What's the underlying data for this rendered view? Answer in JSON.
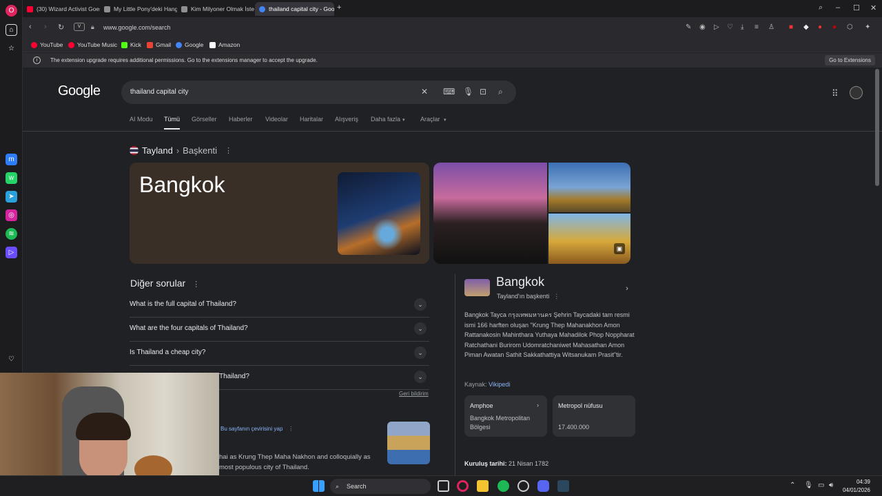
{
  "tabs": [
    {
      "label": "(30) Wizard Activist Goes T",
      "color": "#ff0033"
    },
    {
      "label": "My Little Pony'deki Hangi",
      "color": "#8e8e93"
    },
    {
      "label": "Kim Milyoner Olmak İster",
      "color": "#8e8e93"
    },
    {
      "label": "thailand capital city - Goo",
      "color": "#4285f4"
    }
  ],
  "address": {
    "url": "www.google.com/search",
    "vpn": "V"
  },
  "bookmarks": [
    {
      "label": "YouTube",
      "color": "#ff0033"
    },
    {
      "label": "YouTube Music",
      "color": "#ff0033"
    },
    {
      "label": "Kick",
      "color": "#53fc18"
    },
    {
      "label": "Gmail",
      "color": "#ea4335"
    },
    {
      "label": "Google",
      "color": "#4285f4"
    },
    {
      "label": "Amazon",
      "color": "#ffffff"
    }
  ],
  "notice": {
    "text": "The extension upgrade requires additional permissions. Go to the extensions manager to accept the upgrade.",
    "button": "Go to Extensions"
  },
  "google": {
    "logo": "Google",
    "query": "thailand capital city",
    "filters": [
      "AI Modu",
      "Tümü",
      "Görseller",
      "Haberler",
      "Videolar",
      "Haritalar",
      "Alışveriş",
      "Daha fazla",
      "Araçlar"
    ],
    "active_filter": "Tümü"
  },
  "breadcrumb": {
    "country": "Tayland",
    "sep": "›",
    "attr": "Başkenti"
  },
  "answer": {
    "title": "Bangkok"
  },
  "paa": {
    "heading": "Diğer sorular",
    "questions": [
      "What is the full capital of Thailand?",
      "What are the four capitals of Thailand?",
      "Is Thailand a cheap city?",
      "Thailand?"
    ],
    "feedback": "Geri bildirim"
  },
  "result2": {
    "translate": "Bu sayfanın çevirisini yap",
    "snippet": "hai as Krung Thep Maha Nakhon and colloquially as most populous city of Thailand."
  },
  "knowledge_panel": {
    "title": "Bangkok",
    "subtitle": "Tayland'ın başkenti",
    "description": "Bangkok Tayca กรุงเทพมหานคร Şehrin Taycadaki tam resmi ismi 166 harften oluşan \"Krung Thep Mahanakhon Amon Rattanakosin Mahinthara Yuthaya Mahadilok Phop Noppharat Ratchathani Burirom Udomratchaniwet Mahasathan Amon Piman Awatan Sathit Sakkathattiya Witsanukam Prasit\"tir.",
    "source_label": "Kaynak:",
    "source": "Vikipedi",
    "cards": [
      {
        "label": "Amphoe",
        "value": "Bangkok Metropolitan Bölgesi"
      },
      {
        "label": "Metropol nüfusu",
        "value": "17.400.000"
      }
    ],
    "fact_label": "Kuruluş tarihi:",
    "fact_value": "21 Nisan 1782"
  },
  "taskbar": {
    "search": "Search",
    "time": "04:39",
    "date": "04/01/2026"
  }
}
